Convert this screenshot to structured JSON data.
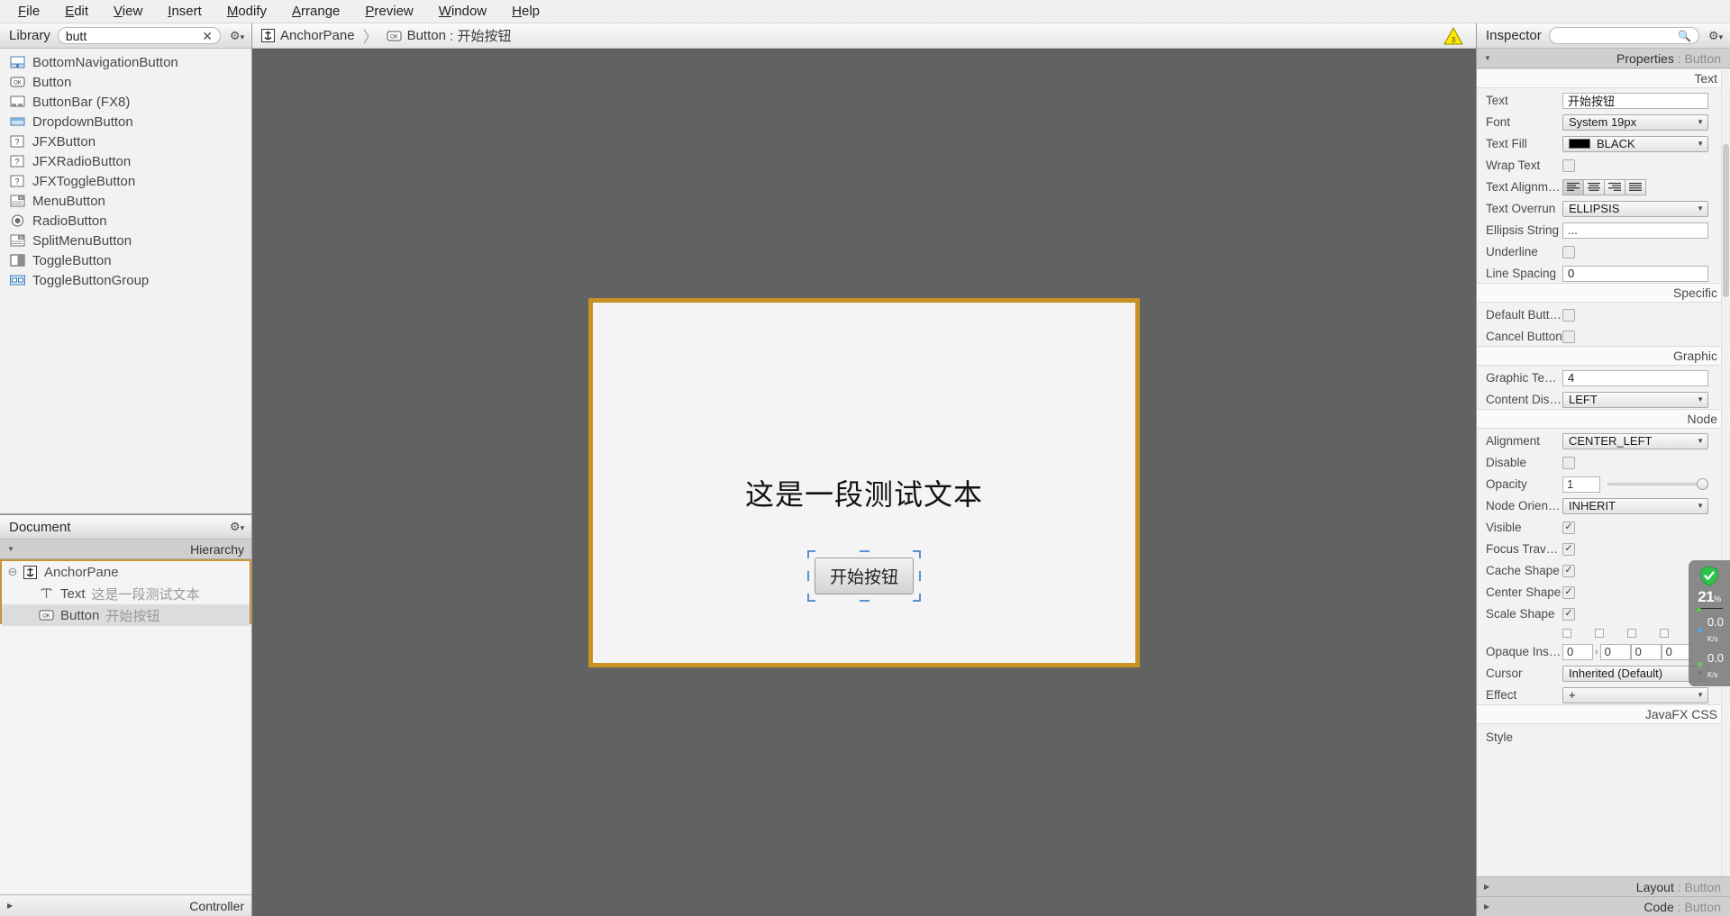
{
  "menubar": {
    "items": [
      {
        "label": "File",
        "accel": "F"
      },
      {
        "label": "Edit",
        "accel": "E"
      },
      {
        "label": "View",
        "accel": "V"
      },
      {
        "label": "Insert",
        "accel": "I"
      },
      {
        "label": "Modify",
        "accel": "M"
      },
      {
        "label": "Arrange",
        "accel": "A"
      },
      {
        "label": "Preview",
        "accel": "P"
      },
      {
        "label": "Window",
        "accel": "W"
      },
      {
        "label": "Help",
        "accel": "H"
      }
    ]
  },
  "library": {
    "title": "Library",
    "search_value": "butt",
    "search_placeholder": "",
    "clear_icon": "close-icon",
    "gear_icon": "gear-icon",
    "items": [
      {
        "label": "BottomNavigationButton",
        "icon": "bottom-navigation-button-icon"
      },
      {
        "label": "Button",
        "icon": "button-ok-icon"
      },
      {
        "label": "ButtonBar  (FX8)",
        "icon": "button-bar-icon"
      },
      {
        "label": "DropdownButton",
        "icon": "dropdown-button-icon"
      },
      {
        "label": "JFXButton",
        "icon": "question-icon"
      },
      {
        "label": "JFXRadioButton",
        "icon": "question-icon"
      },
      {
        "label": "JFXToggleButton",
        "icon": "question-icon"
      },
      {
        "label": "MenuButton",
        "icon": "menu-button-icon"
      },
      {
        "label": "RadioButton",
        "icon": "radio-button-icon"
      },
      {
        "label": "SplitMenuButton",
        "icon": "split-menu-button-icon"
      },
      {
        "label": "ToggleButton",
        "icon": "toggle-button-icon"
      },
      {
        "label": "ToggleButtonGroup",
        "icon": "toggle-button-group-icon"
      }
    ]
  },
  "document": {
    "title": "Document",
    "gear_icon": "gear-icon",
    "hierarchy_label": "Hierarchy",
    "tree": [
      {
        "type": "AnchorPane",
        "value": "",
        "icon": "anchor-pane-icon",
        "depth": 0,
        "selected": false,
        "expanded": true
      },
      {
        "type": "Text",
        "value": "这是一段测试文本",
        "icon": "text-icon",
        "depth": 1,
        "selected": false
      },
      {
        "type": "Button",
        "value": "开始按钮",
        "icon": "button-ok-icon",
        "depth": 1,
        "selected": true
      }
    ],
    "controller_label": "Controller"
  },
  "breadcrumb": {
    "items": [
      {
        "label": "AnchorPane",
        "value": "",
        "icon": "anchor-pane-icon"
      },
      {
        "label": "Button",
        "value": "开始按钮",
        "icon": "button-ok-icon"
      }
    ],
    "separator": "〉",
    "warning_icon": "warning-triangle-icon",
    "warning_count": "3"
  },
  "canvas": {
    "text_node": "这是一段测试文本",
    "button_label": "开始按钮",
    "selection_color": "#5b8fd4",
    "stage_border_color": "#c69323"
  },
  "inspector": {
    "title": "Inspector",
    "search_value": "",
    "search_icon": "search-icon",
    "gear_icon": "gear-icon",
    "properties_label": "Properties",
    "properties_target": "Button",
    "sections": {
      "text": {
        "header": "Text",
        "rows": [
          {
            "label": "Text",
            "kind": "input",
            "value": "开始按钮"
          },
          {
            "label": "Font",
            "kind": "combo",
            "value": "System 19px"
          },
          {
            "label": "Text Fill",
            "kind": "color",
            "value": "BLACK",
            "color": "#000000"
          },
          {
            "label": "Wrap Text",
            "kind": "checkbox",
            "checked": false
          },
          {
            "label": "Text Alignment",
            "kind": "segments",
            "selected": 0,
            "options": [
              "align-left",
              "align-center",
              "align-right",
              "align-justify"
            ]
          },
          {
            "label": "Text Overrun",
            "kind": "combo",
            "value": "ELLIPSIS"
          },
          {
            "label": "Ellipsis String",
            "kind": "input",
            "value": "..."
          },
          {
            "label": "Underline",
            "kind": "checkbox",
            "checked": false
          },
          {
            "label": "Line Spacing",
            "kind": "input",
            "value": "0"
          }
        ]
      },
      "specific": {
        "header": "Specific",
        "rows": [
          {
            "label": "Default Button",
            "kind": "checkbox",
            "checked": false
          },
          {
            "label": "Cancel Button",
            "kind": "checkbox",
            "checked": false
          }
        ]
      },
      "graphic": {
        "header": "Graphic",
        "rows": [
          {
            "label": "Graphic Text Gap",
            "kind": "input",
            "value": "4"
          },
          {
            "label": "Content Display",
            "kind": "combo",
            "value": "LEFT"
          }
        ]
      },
      "node": {
        "header": "Node",
        "rows": [
          {
            "label": "Alignment",
            "kind": "combo",
            "value": "CENTER_LEFT"
          },
          {
            "label": "Disable",
            "kind": "checkbox",
            "checked": false
          },
          {
            "label": "Opacity",
            "kind": "slider",
            "value": "1"
          },
          {
            "label": "Node Orientati...",
            "kind": "combo",
            "value": "INHERIT"
          },
          {
            "label": "Visible",
            "kind": "checkbox",
            "checked": true
          },
          {
            "label": "Focus Traversa...",
            "kind": "checkbox",
            "checked": true
          },
          {
            "label": "Cache Shape",
            "kind": "checkbox",
            "checked": true
          },
          {
            "label": "Center Shape",
            "kind": "checkbox",
            "checked": true
          },
          {
            "label": "Scale Shape",
            "kind": "checkbox",
            "checked": true
          },
          {
            "label": "Opaque Insets",
            "kind": "insets",
            "values": [
              "0",
              "0",
              "0",
              "0"
            ]
          },
          {
            "label": "Cursor",
            "kind": "combo",
            "value": "Inherited (Default)"
          },
          {
            "label": "Effect",
            "kind": "combo",
            "value": "+"
          }
        ]
      },
      "javafx_css": {
        "header": "JavaFX CSS",
        "rows": [
          {
            "label": "Style",
            "kind": "label"
          }
        ]
      }
    },
    "bottom_sections": [
      {
        "label": "Layout",
        "target": "Button"
      },
      {
        "label": "Code",
        "target": "Button"
      }
    ]
  },
  "net_monitor": {
    "shield_icon": "shield-check-icon",
    "percent": "21",
    "percent_unit": "%",
    "upload_value": "0.0",
    "upload_unit": "K/s",
    "download_value": "0.0",
    "download_unit": "K/s"
  }
}
